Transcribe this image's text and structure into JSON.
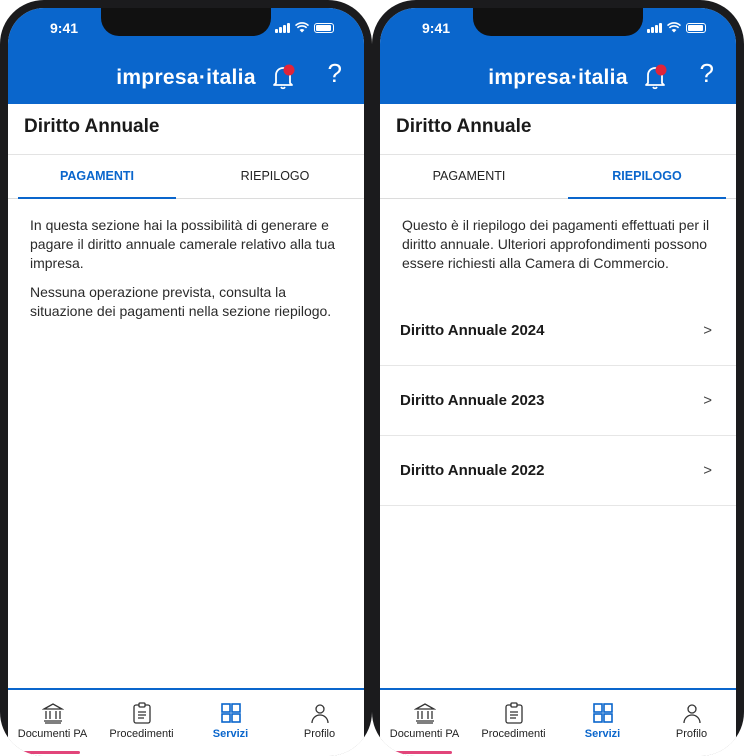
{
  "status": {
    "time": "9:41"
  },
  "brand": "impresa·italia",
  "help_glyph": "?",
  "colors": {
    "primary": "#0a66cc",
    "notification_dot": "#e0243a",
    "indicator": "#e2457a"
  },
  "screens": [
    {
      "title": "Diritto Annuale",
      "tabs": [
        {
          "label": "PAGAMENTI",
          "active": true
        },
        {
          "label": "RIEPILOGO",
          "active": false
        }
      ],
      "paragraphs": [
        "In questa sezione hai la possibilità di generare e pagare il diritto annuale camerale relativo alla tua impresa.",
        "Nessuna operazione prevista, consulta la situazione dei pagamenti nella sezione riepilogo."
      ]
    },
    {
      "title": "Diritto Annuale",
      "tabs": [
        {
          "label": "PAGAMENTI",
          "active": false
        },
        {
          "label": "RIEPILOGO",
          "active": true
        }
      ],
      "paragraphs": [
        "Questo è il riepilogo dei pagamenti effettuati per il diritto annuale. Ulteriori approfondimenti possono essere richiesti alla Camera di Commercio."
      ],
      "items": [
        {
          "label": "Diritto Annuale 2024",
          "chevron": ">"
        },
        {
          "label": "Diritto Annuale 2023",
          "chevron": ">"
        },
        {
          "label": "Diritto Annuale 2022",
          "chevron": ">"
        }
      ]
    }
  ],
  "nav": [
    {
      "label": "Documenti PA",
      "icon": "bank-icon",
      "active": false
    },
    {
      "label": "Procedimenti",
      "icon": "clipboard-icon",
      "active": false
    },
    {
      "label": "Servizi",
      "icon": "grid-icon",
      "active": true
    },
    {
      "label": "Profilo",
      "icon": "user-icon",
      "active": false
    }
  ]
}
